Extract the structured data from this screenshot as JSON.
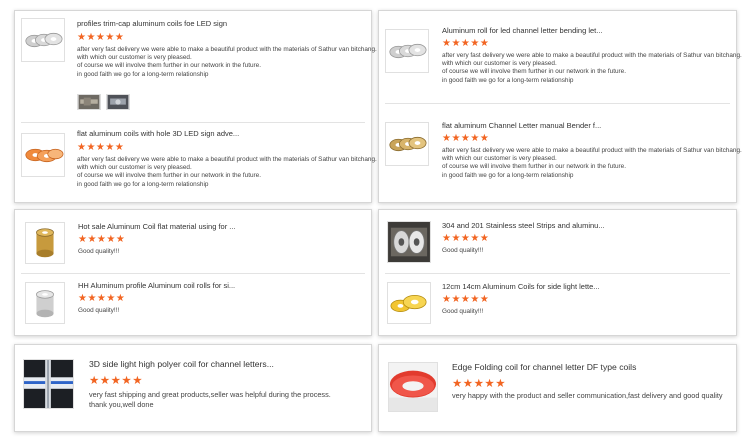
{
  "reviews": [
    {
      "title": "profiles trim-cap aluminum coils foe LED sign",
      "stars": "★★★★★",
      "lines": [
        "after very fast delivery we were able to make a beautiful product with the materials of Sathur van bitchang.",
        "with which our customer is very pleased.",
        "of course we will involve them further in our network in the future.",
        "in good faith we go for a long-term relationship"
      ],
      "thumb_icon": "silver-coils-image",
      "photos": [
        "review-photo-1",
        "review-photo-2"
      ]
    },
    {
      "title": "flat aluminum coils with hole 3D LED sign adve...",
      "stars": "★★★★★",
      "lines": [
        "after very fast delivery we were able to make a beautiful product with the materials of Sathur van bitchang.",
        "with which our customer is very pleased.",
        "of course we will involve them further in our network in the future.",
        "in good faith we go for a long-term relationship"
      ],
      "thumb_icon": "orange-coils-image"
    },
    {
      "title": "Aluminum roll for led channel letter bending let...",
      "stars": "★★★★★",
      "lines": [
        "after very fast delivery we were able to make a beautiful product with the materials of Sathur van bitchang.",
        "with which our customer is very pleased.",
        "of course we will involve them further in our network in the future.",
        "in good faith we go for a long-term relationship"
      ],
      "thumb_icon": "silver-coils-image"
    },
    {
      "title": "flat aluminum Channel Letter manual Bender f...",
      "stars": "★★★★★",
      "lines": [
        "after very fast delivery we were able to make a beautiful product with the materials of Sathur van bitchang.",
        "with which our customer is very pleased.",
        "of course we will involve them further in our network in the future.",
        "in good faith we go for a long-term relationship"
      ],
      "thumb_icon": "gold-coils-image"
    },
    {
      "title": "Hot sale Aluminum Coil flat material using for ...",
      "stars": "★★★★★",
      "lines": [
        "Good quality!!!"
      ],
      "thumb_icon": "gold-coil-image"
    },
    {
      "title": "HH Aluminum profile Aluminum coil rolls for si...",
      "stars": "★★★★★",
      "lines": [
        "Good quality!!!"
      ],
      "thumb_icon": "silver-coil-image"
    },
    {
      "title": "304 and 201 Stainless steel Strips and aluminu...",
      "stars": "★★★★★",
      "lines": [
        "Good quality!!!"
      ],
      "thumb_icon": "steel-strips-image"
    },
    {
      "title": "12cm 14cm Aluminum Coils for side light lette...",
      "stars": "★★★★★",
      "lines": [
        "Good quality!!!"
      ],
      "thumb_icon": "yellow-coils-image"
    },
    {
      "title": "3D side light high polyer coil for channel letters...",
      "stars": "★★★★★",
      "lines": [
        "very fast shipping and great products,seller was helpful during the process.",
        "thank you,well done"
      ],
      "thumb_icon": "polymer-coil-photo"
    },
    {
      "title": "Edge Folding coil for channel letter DF type coils",
      "stars": "★★★★★",
      "lines": [
        "very happy with the product and seller communication,fast delivery and good quality"
      ],
      "thumb_icon": "red-coil-photo"
    }
  ]
}
